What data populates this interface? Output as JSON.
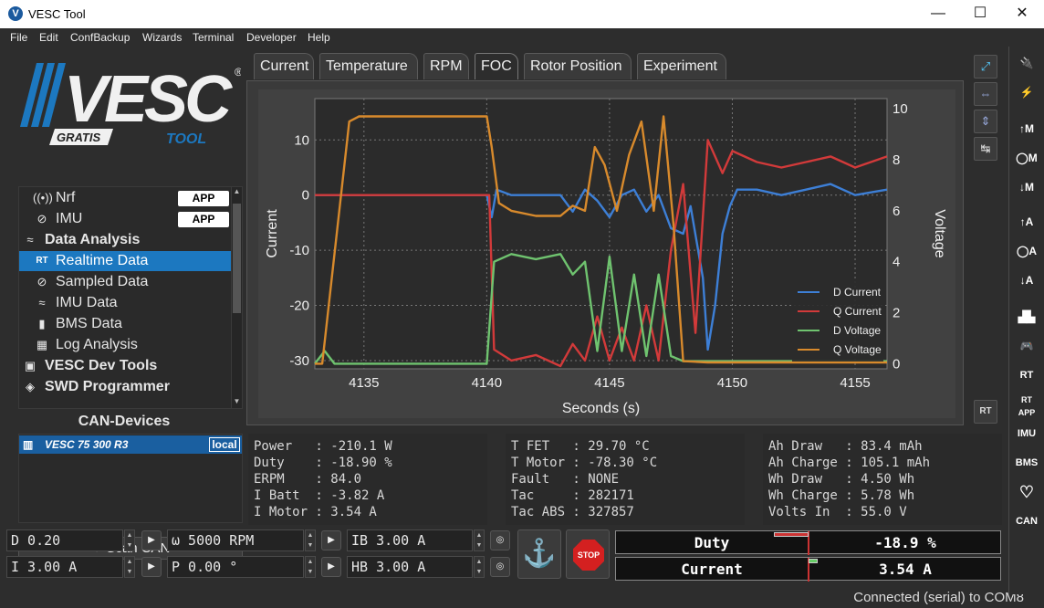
{
  "window": {
    "title": "VESC Tool",
    "minimize": "—",
    "maximize": "☐",
    "close": "✕"
  },
  "menu": [
    "File",
    "Edit",
    "ConfBackup",
    "Wizards",
    "Terminal",
    "Developer",
    "Help"
  ],
  "brand": {
    "main": "VESC",
    "gratis": "GRATIS",
    "tool": "TOOL",
    "reg": "®"
  },
  "nav": [
    {
      "icon": "((•))",
      "label": "Nrf",
      "badge": "APP"
    },
    {
      "icon": "⊘",
      "label": "IMU",
      "badge": "APP"
    },
    {
      "icon": "≈",
      "label": "Data Analysis",
      "header": true
    },
    {
      "icon": "RT",
      "label": "Realtime Data",
      "selected": true
    },
    {
      "icon": "⊘",
      "label": "Sampled Data"
    },
    {
      "icon": "≈",
      "label": "IMU Data"
    },
    {
      "icon": "▮",
      "label": "BMS Data"
    },
    {
      "icon": "▦",
      "label": "Log Analysis"
    },
    {
      "icon": "▣",
      "label": "VESC Dev Tools",
      "header": true
    },
    {
      "icon": "◈",
      "label": "SWD Programmer",
      "header": true
    }
  ],
  "can": {
    "header": "CAN-Devices",
    "device": "VESC  75 300 R3",
    "device_tag": "local",
    "scan": "Scan CAN",
    "scan_icon": "↻"
  },
  "tabs": [
    "Current",
    "Temperature",
    "RPM",
    "FOC",
    "Rotor Position",
    "Experiment"
  ],
  "active_tab": "FOC",
  "chart_data": {
    "type": "line",
    "xlabel": "Seconds (s)",
    "ylabel": "Current",
    "y2label": "Voltage",
    "xlim": [
      4133,
      4156.3
    ],
    "ylim": [
      -31.5,
      17.5
    ],
    "y2lim": [
      -0.2,
      10.4
    ],
    "xticks": [
      4135,
      4140,
      4145,
      4150,
      4155
    ],
    "yticks": [
      10,
      0,
      -10,
      -20,
      -30
    ],
    "y2ticks": [
      10,
      8,
      6,
      4,
      2,
      0
    ],
    "legend_position": "bottom-right",
    "series": [
      {
        "name": "D Current",
        "color": "#3d7fd6",
        "axis": "left",
        "x": [
          4133,
          4140,
          4140.2,
          4140.4,
          4141,
          4142,
          4143,
          4143.5,
          4144,
          4144.5,
          4145,
          4145.5,
          4146,
          4146.5,
          4147,
          4147.5,
          4148,
          4148.3,
          4148.8,
          4149,
          4149.3,
          4149.6,
          4149.9,
          4150.2,
          4151,
          4152,
          4153,
          4154,
          4155,
          4156.3
        ],
        "y": [
          0,
          0,
          -4,
          1,
          0,
          0,
          0,
          -3,
          1,
          -1,
          -4,
          0,
          1,
          -3,
          0,
          -6,
          -7,
          -2,
          -15,
          -28,
          -20,
          -7,
          -2,
          1,
          1,
          0,
          1,
          2,
          0,
          1
        ]
      },
      {
        "name": "Q Current",
        "color": "#d23a3a",
        "axis": "left",
        "x": [
          4133,
          4140.1,
          4140.3,
          4141,
          4142,
          4143,
          4143.5,
          4144,
          4144.5,
          4145,
          4145.5,
          4146,
          4146.5,
          4147,
          4147.5,
          4148,
          4148.5,
          4149,
          4149.3,
          4149.6,
          4150,
          4151,
          4152,
          4153,
          4154,
          4155,
          4156.3
        ],
        "y": [
          0,
          0,
          -28,
          -30,
          -29,
          -31,
          -27,
          -30,
          -22,
          -30,
          -24,
          -30,
          -20,
          -30,
          -10,
          2,
          -25,
          10,
          7,
          4,
          8,
          6,
          5,
          6,
          7,
          5,
          7
        ]
      },
      {
        "name": "D Voltage",
        "color": "#6fc36f",
        "axis": "right",
        "x": [
          4133,
          4133.4,
          4133.8,
          4140,
          4140.3,
          4141,
          4142,
          4143,
          4143.5,
          4144,
          4144.5,
          4145,
          4145.5,
          4146,
          4146.5,
          4147,
          4147.5,
          4148,
          4149,
          4150,
          4151,
          4152,
          4153,
          4154,
          4155,
          4156.3
        ],
        "y": [
          0,
          0.5,
          0,
          0,
          4,
          4.3,
          4.1,
          4.3,
          3.5,
          4.0,
          0.5,
          4.2,
          0.5,
          3.5,
          0.3,
          3.5,
          0.3,
          0.1,
          0.1,
          0.1,
          0.1,
          0.1,
          0.1,
          0.1,
          0.1,
          0.1
        ]
      },
      {
        "name": "Q Voltage",
        "color": "#d88a2c",
        "axis": "right",
        "x": [
          4133,
          4133.3,
          4134.4,
          4134.8,
          4140,
          4140.2,
          4140.5,
          4141,
          4142,
          4143,
          4143.5,
          4144,
          4144.4,
          4144.8,
          4145.3,
          4145.8,
          4146.3,
          4146.8,
          4147.2,
          4147.6,
          4148,
          4149,
          4150,
          4151,
          4152,
          4153,
          4154,
          4155,
          4156.3
        ],
        "y": [
          0,
          0,
          9.5,
          9.7,
          9.7,
          8.5,
          6.3,
          6.0,
          5.8,
          5.8,
          6.2,
          6.0,
          8.5,
          7.8,
          6.0,
          8.2,
          9.5,
          6.0,
          9.7,
          5.5,
          0.1,
          0.05,
          0.05,
          0.05,
          0.05,
          0.05,
          0.05,
          0.05,
          0.05
        ]
      }
    ]
  },
  "stats1": [
    "Power   : -210.1 W",
    "Duty    : -18.90 %",
    "ERPM    : 84.0",
    "I Batt  : -3.82 A",
    "I Motor : 3.54 A"
  ],
  "stats2": [
    "T FET   : 29.70 °C",
    "T Motor : -78.30 °C",
    "Fault   : NONE",
    "Tac     : 282171",
    "Tac ABS : 327857"
  ],
  "stats3": [
    "Ah Draw   : 83.4 mAh",
    "Ah Charge : 105.1 mAh",
    "Wh Draw   : 4.50 Wh",
    "Wh Charge : 5.78 Wh",
    "Volts In  : 55.0 V"
  ],
  "controls": {
    "duty": "D 0.20",
    "current": "I 3.00 A",
    "rpm": "ω 5000 RPM",
    "pos": "P 0.00 °",
    "brake": "IB 3.00 A",
    "handbrake": "HB 3.00 A",
    "stop": "STOP"
  },
  "gauges": [
    {
      "name": "Duty",
      "value": "-18.9 %",
      "fraction": -0.189,
      "color": "#c33"
    },
    {
      "name": "Current",
      "value": "3.54 A",
      "fraction": 0.035,
      "color": "#6c6"
    }
  ],
  "status": "Connected (serial) to COM8",
  "sidebar": [
    "🔌",
    "⚡",
    "↑M",
    "◯M",
    "↓M",
    "↑A",
    "◯A",
    "↓A",
    "▟▙",
    "🎮",
    "RT",
    "RT APP",
    "IMU",
    "BMS",
    "♡",
    "CAN"
  ]
}
